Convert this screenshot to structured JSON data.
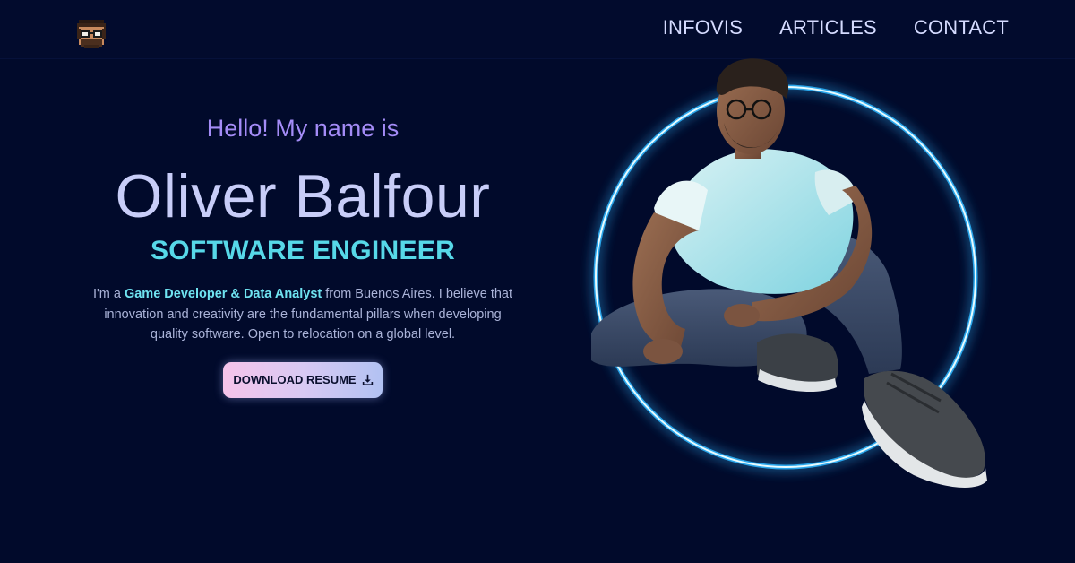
{
  "header": {
    "logo_icon": "pixel-avatar-icon",
    "nav": [
      {
        "label": "INFOVIS"
      },
      {
        "label": "ARTICLES"
      },
      {
        "label": "CONTACT"
      }
    ]
  },
  "hero": {
    "greeting": "Hello! My name is",
    "name": "Oliver Balfour",
    "role": "SOFTWARE ENGINEER",
    "bio": {
      "prefix": "I'm a ",
      "highlight": "Game Developer & Data Analyst",
      "suffix": " from Buenos Aires. I believe that innovation and creativity are the fundamental pillars when developing quality software. Open to relocation on a global level."
    },
    "button_label": "DOWNLOAD RESUME",
    "button_icon": "download-icon"
  },
  "illustration": {
    "ring_color": "#2fb6ff",
    "subject": "3d-avatar-sitting"
  },
  "colors": {
    "background": "#010a2b",
    "greeting": "#a48cf7",
    "name": "#c8cdf8",
    "role": "#57d8e8",
    "highlight": "#6fe3f1"
  }
}
